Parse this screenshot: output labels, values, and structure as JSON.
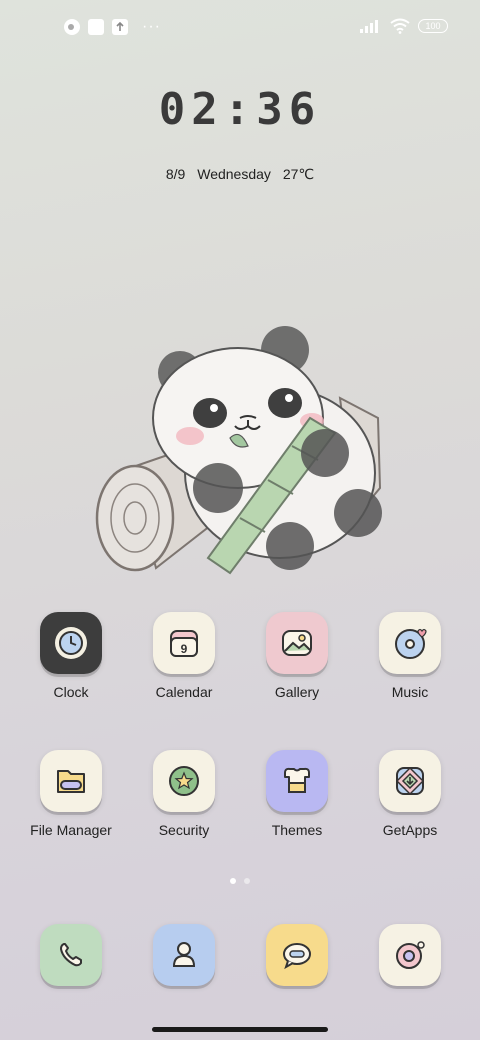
{
  "status_bar": {
    "battery": "100",
    "dots": "···"
  },
  "clock": {
    "time": "02:36",
    "date": "8/9",
    "weekday": "Wednesday",
    "temperature": "27℃"
  },
  "apps": {
    "row1": [
      {
        "label": "Clock",
        "icon": "clock-icon",
        "bg": "#3d3d3d"
      },
      {
        "label": "Calendar",
        "icon": "calendar-icon",
        "bg": "#f6f2e4"
      },
      {
        "label": "Gallery",
        "icon": "gallery-icon",
        "bg": "#efc9cf"
      },
      {
        "label": "Music",
        "icon": "music-icon",
        "bg": "#f6f2e4"
      }
    ],
    "row2": [
      {
        "label": "File Manager",
        "icon": "folder-icon",
        "bg": "#f6f2e4"
      },
      {
        "label": "Security",
        "icon": "security-icon",
        "bg": "#f6f2e4"
      },
      {
        "label": "Themes",
        "icon": "themes-icon",
        "bg": "#b9b8f2"
      },
      {
        "label": "GetApps",
        "icon": "getapps-icon",
        "bg": "#f6f2e4"
      }
    ]
  },
  "calendar_day": "9",
  "dock": [
    {
      "name": "phone",
      "icon": "phone-icon",
      "bg": "#bfdcbf"
    },
    {
      "name": "contacts",
      "icon": "contacts-icon",
      "bg": "#b7cdef"
    },
    {
      "name": "messages",
      "icon": "messages-icon",
      "bg": "#f7db8c"
    },
    {
      "name": "camera",
      "icon": "camera-icon",
      "bg": "#f6f2e4"
    }
  ],
  "page_indicator": {
    "pages": 2,
    "current": 1
  }
}
